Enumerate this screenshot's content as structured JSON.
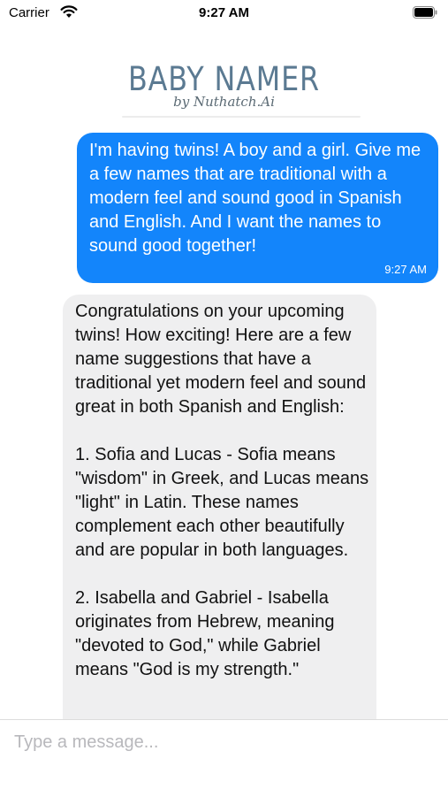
{
  "status_bar": {
    "carrier": "Carrier",
    "time": "9:27 AM"
  },
  "header": {
    "title": "BABY NAMER",
    "subtitle": "by Nuthatch.Ai"
  },
  "messages": {
    "outgoing": {
      "text": "I'm having twins! A boy and a girl. Give me a few names that are traditional with a modern feel and sound good in Spanish and English. And I want the names to sound good together!",
      "time": "9:27 AM"
    },
    "incoming": {
      "text": "Congratulations on your upcoming twins! How exciting! Here are a few name suggestions that have a traditional yet modern feel and sound great in both Spanish and English:\n\n1. Sofia and Lucas - Sofia means \"wisdom\" in Greek, and Lucas means \"light\" in Latin. These names complement each other beautifully and are popular in both languages.\n\n2. Isabella and Gabriel - Isabella originates from Hebrew, meaning \"devoted to God,\" while Gabriel means \"God is my strength.\""
    }
  },
  "composer": {
    "placeholder": "Type a message..."
  },
  "colors": {
    "outgoing_bubble": "#1385fb",
    "incoming_bubble": "#efeff0",
    "brand": "#5b7a92"
  }
}
